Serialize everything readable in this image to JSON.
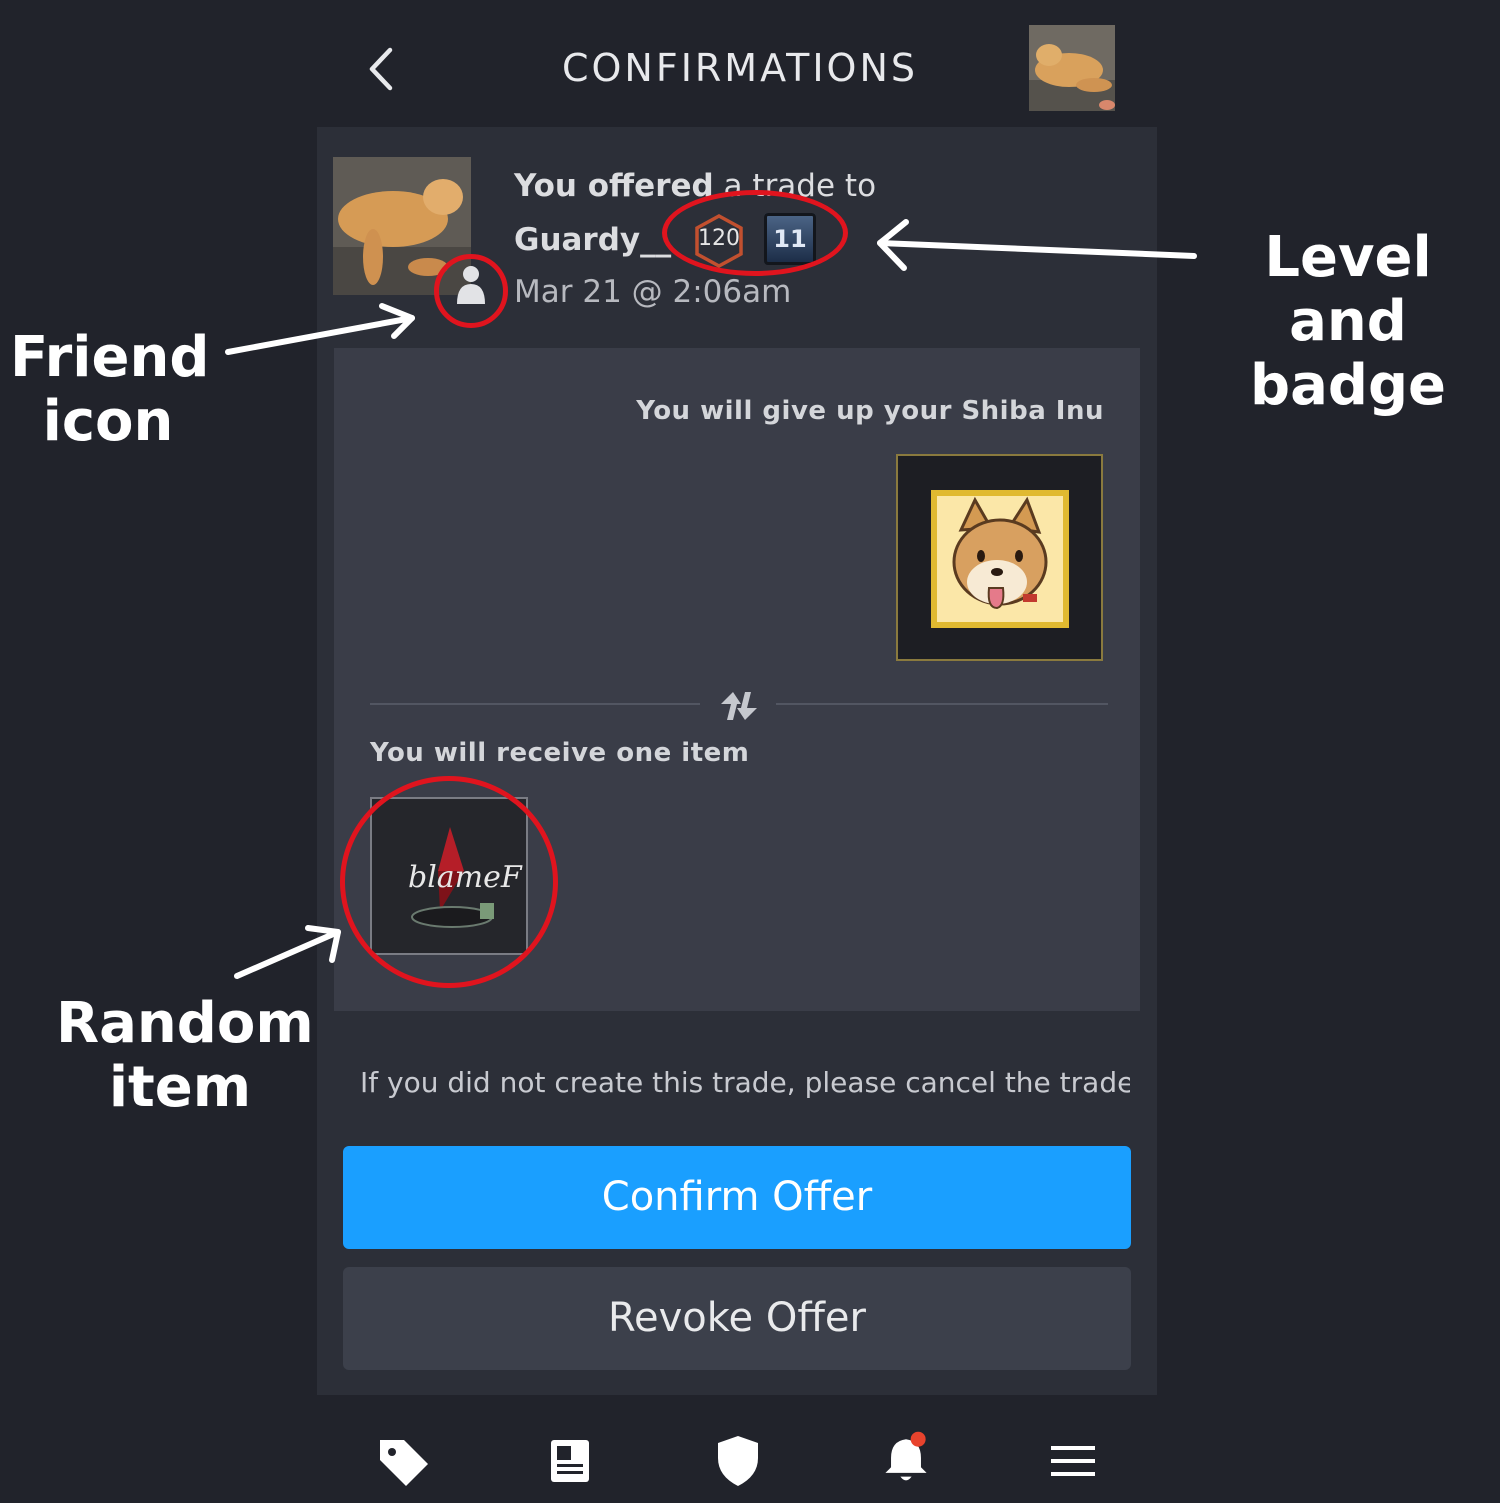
{
  "header": {
    "title": "CONFIRMATIONS",
    "back_icon": "chevron-left-icon"
  },
  "offer": {
    "line1_bold": "You offered",
    "line1_rest": " a trade to",
    "username": "Guardy__",
    "level": "120",
    "badge": "11",
    "timestamp": "Mar 21 @ 2:06am"
  },
  "trade": {
    "give_label": "You will give up your Shiba Inu",
    "receive_label": "You will receive one item",
    "receive_item_text": "blameF"
  },
  "warning": "If you did not create this trade, please cancel the trade",
  "buttons": {
    "confirm": "Confirm Offer",
    "revoke": "Revoke Offer"
  },
  "nav": [
    "tag-icon",
    "news-icon",
    "shield-icon",
    "bell-icon",
    "menu-icon"
  ],
  "annotations": {
    "friend_icon": "Friend icon",
    "level_badge": "Level and badge",
    "random_item": "Random item"
  },
  "colors": {
    "background": "#21232b",
    "confirm": "#1a9fff",
    "annotation_ring": "#e0141e",
    "notification_dot": "#e8432d"
  }
}
